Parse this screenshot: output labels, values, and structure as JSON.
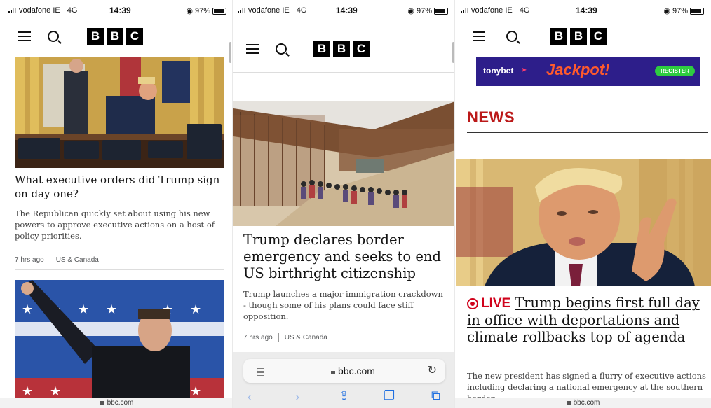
{
  "status_bars": [
    {
      "carrier": "vodafone IE",
      "network": "4G",
      "time": "14:39",
      "battery": "97%"
    },
    {
      "carrier": "vodafone IE",
      "network": "4G",
      "time": "14:39",
      "battery": "97%"
    },
    {
      "carrier": "vodafone IE",
      "network": "4G",
      "time": "14:39",
      "battery": "97%"
    }
  ],
  "logo_letters": [
    "B",
    "B",
    "C"
  ],
  "panel1": {
    "headline": "What executive orders did Trump sign on day one?",
    "summary": "The Republican quickly set about using his new powers to approve executive actions on a host of policy priorities.",
    "time": "7 hrs ago",
    "section": "US & Canada",
    "url": "bbc.com"
  },
  "panel2": {
    "headline": "Trump declares border emergency and seeks to end US birthright citizenship",
    "summary": "Trump launches a major immigration crackdown - though some of his plans could face stiff opposition.",
    "time": "7 hrs ago",
    "section": "US & Canada",
    "url": "bbc.com"
  },
  "panel3": {
    "ad_brand": "tonybet",
    "ad_text": "Jackpot!",
    "ad_button": "REGISTER",
    "section_title": "NEWS",
    "live_label": "LIVE",
    "headline": "Trump begins first full day in office with deportations and climate rollbacks top of agenda",
    "summary": "The new president has signed a flurry of executive actions including declaring a national emergency at the southern border",
    "url": "bbc.com"
  },
  "colors": {
    "live_red": "#d0021b",
    "news_red": "#bb1919",
    "ad_bg": "#2d1e8a",
    "ad_jackpot": "#ff5a2c",
    "ad_green": "#2ecc40",
    "safari_blue": "#1f6fe0"
  },
  "icons": [
    "menu-icon",
    "search-icon",
    "lock-icon",
    "reload-icon",
    "back-icon",
    "forward-icon",
    "share-icon",
    "bookmarks-icon",
    "tabs-icon",
    "reader-icon"
  ]
}
